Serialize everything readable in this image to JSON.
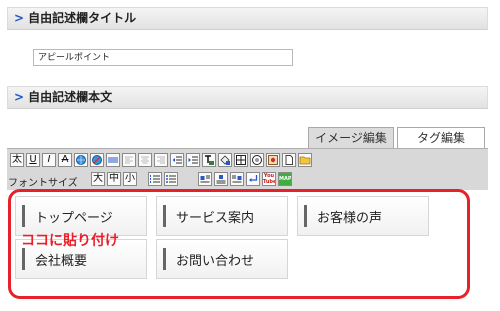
{
  "free_title_section": {
    "heading": "自由記述欄タイトル",
    "chevron": ">"
  },
  "title_input": {
    "value": "アピールポイント"
  },
  "free_body_section": {
    "heading": "自由記述欄本文",
    "chevron": ">"
  },
  "mode_tabs": [
    {
      "label": "イメージ編集",
      "active": false
    },
    {
      "label": "タグ編集",
      "active": true
    }
  ],
  "toolbar": {
    "row1_text_buttons": [
      "太",
      "U",
      "I",
      "A"
    ],
    "font_size_label": "フォントサイズ",
    "font_size_buttons": [
      "大",
      "中",
      "小"
    ],
    "youtube_label": "You Tube",
    "map_label": "MAP"
  },
  "nav_buttons": [
    {
      "label": "トップページ"
    },
    {
      "label": "サービス案内"
    },
    {
      "label": "お客様の声"
    },
    {
      "label": "会社概要"
    },
    {
      "label": "お問い合わせ"
    }
  ],
  "paste_caption": "ココに貼り付け",
  "colors": {
    "accent_blue": "#1d58c4",
    "highlight_red": "#e8202a",
    "toolbar_gray": "#d8d8d8"
  }
}
